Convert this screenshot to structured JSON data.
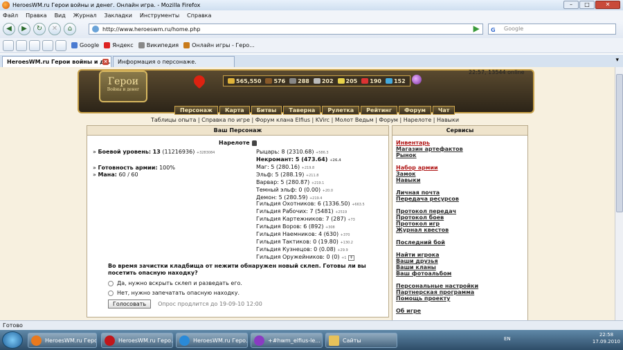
{
  "window": {
    "title": "HeroesWM.ru Герои войны и денег. Онлайн игра. - Mozilla Firefox"
  },
  "menu": [
    "Файл",
    "Правка",
    "Вид",
    "Журнал",
    "Закладки",
    "Инструменты",
    "Справка"
  ],
  "nav": {
    "url": "http://www.heroeswm.ru/home.php",
    "search_placeholder": "Google"
  },
  "bookmarks": [
    "Google",
    "Яндекс",
    "Википедия",
    "Онлайн игры - Геро..."
  ],
  "tabs": [
    {
      "label": "HeroesWM.ru Герои войны и де..."
    },
    {
      "label": "Информация о персонаже."
    }
  ],
  "header": {
    "logo": "Герои",
    "logo_sub": "Войны и денег",
    "time": "22:57, 13544 online",
    "resources": [
      "565,550",
      "576",
      "288",
      "202",
      "205",
      "190",
      "152"
    ],
    "menu": [
      "Персонаж",
      "Карта",
      "Битвы",
      "Таверна",
      "Рулетка",
      "Рейтинг",
      "Форум",
      "Чат"
    ],
    "sublinks": "Таблицы опыта | Справка по игре | Форум клана Elfius | KVirc | Молот Ведьм | Форум | Нарелоте | Навыки"
  },
  "main": {
    "title": "Ваш Персонаж",
    "name": "Нарелоте",
    "stats": {
      "combat_label": "Боевой уровень:",
      "combat_value": "13",
      "combat_exp": "(11216936)",
      "combat_small": "+3283084",
      "army_label": "Готовность армии:",
      "army_value": "100%",
      "mana_label": "Мана:",
      "mana_value": "60 / 60"
    },
    "factions": [
      {
        "text": "Рыцарь: 8 (2310.68)",
        "small": "+586.3"
      },
      {
        "text": "Некромант: 5 (473.64)",
        "small": "+26.4"
      },
      {
        "text": "Маг: 5 (280.16)",
        "small": "+219.8"
      },
      {
        "text": "Эльф: 5 (288.19)",
        "small": "+211.8"
      },
      {
        "text": "Варвар: 5 (280.87)",
        "small": "+219.1"
      },
      {
        "text": "Темный эльф: 0 (0.00)",
        "small": "+20.0"
      },
      {
        "text": "Демон: 5 (280.59)",
        "small": "+219.4"
      }
    ],
    "guilds": [
      {
        "text": "Гильдия Охотников: 6 (1336.50)",
        "small": "+663.5"
      },
      {
        "text": "Гильдия Рабочих: 7 (5481)",
        "small": "+2519"
      },
      {
        "text": "Гильдия Картежников: 7 (287)",
        "small": "+73"
      },
      {
        "text": "Гильдия Воров: 6 (892)",
        "small": "+308"
      },
      {
        "text": "Гильдия Наемников: 4 (630)",
        "small": "+370"
      },
      {
        "text": "Гильдия Тактиков: 0 (19.80)",
        "small": "+130.2"
      },
      {
        "text": "Гильдия Кузнецов: 0 (0.08)",
        "small": "+29.9"
      },
      {
        "text": "Гильдия Оружейников: 0 (0)",
        "small": "+1"
      }
    ],
    "poll": {
      "question": "Во время зачистки кладбища от нежити обнаружен новый склеп. Готовы ли вы посетить опасную находку?",
      "options": [
        "Да, нужно вскрыть склеп и разведать его.",
        "Нет, нужно запечатать опасную находку."
      ],
      "vote": "Голосовать",
      "note": "Опрос продлится до 19-09-10 12:00"
    }
  },
  "services": {
    "title": "Сервисы",
    "groups": [
      [
        "Инвентарь",
        "Магазин артефактов",
        "Рынок"
      ],
      [
        "Набор армии",
        "Замок",
        "Навыки"
      ],
      [
        "Личная почта",
        "Передача ресурсов"
      ],
      [
        "Протокол передач",
        "Протокол боев",
        "Протокол игр",
        "Журнал квестов"
      ],
      [
        "Последний бой"
      ],
      [
        "Найти игрока",
        "Ваши друзья",
        "Ваши кланы",
        "Ваш фотоальбом"
      ],
      [
        "Персональные настройки",
        "Партнерская программа",
        "Помощь проекту"
      ],
      [
        "Об игре"
      ]
    ]
  },
  "status": "Готово",
  "taskbar": {
    "items": [
      "HeroesWM.ru Геро...",
      "HeroesWM.ru Геро...",
      "HeroesWM.ru Геро...",
      "+#hwm_elfius-le...",
      "Сайты"
    ],
    "lang": "EN",
    "time": "22:58",
    "date": "17.09.2010"
  },
  "colors": {
    "accent": "#c9a24a",
    "page_bg": "#f7f0df",
    "link_red": "#b01717"
  }
}
